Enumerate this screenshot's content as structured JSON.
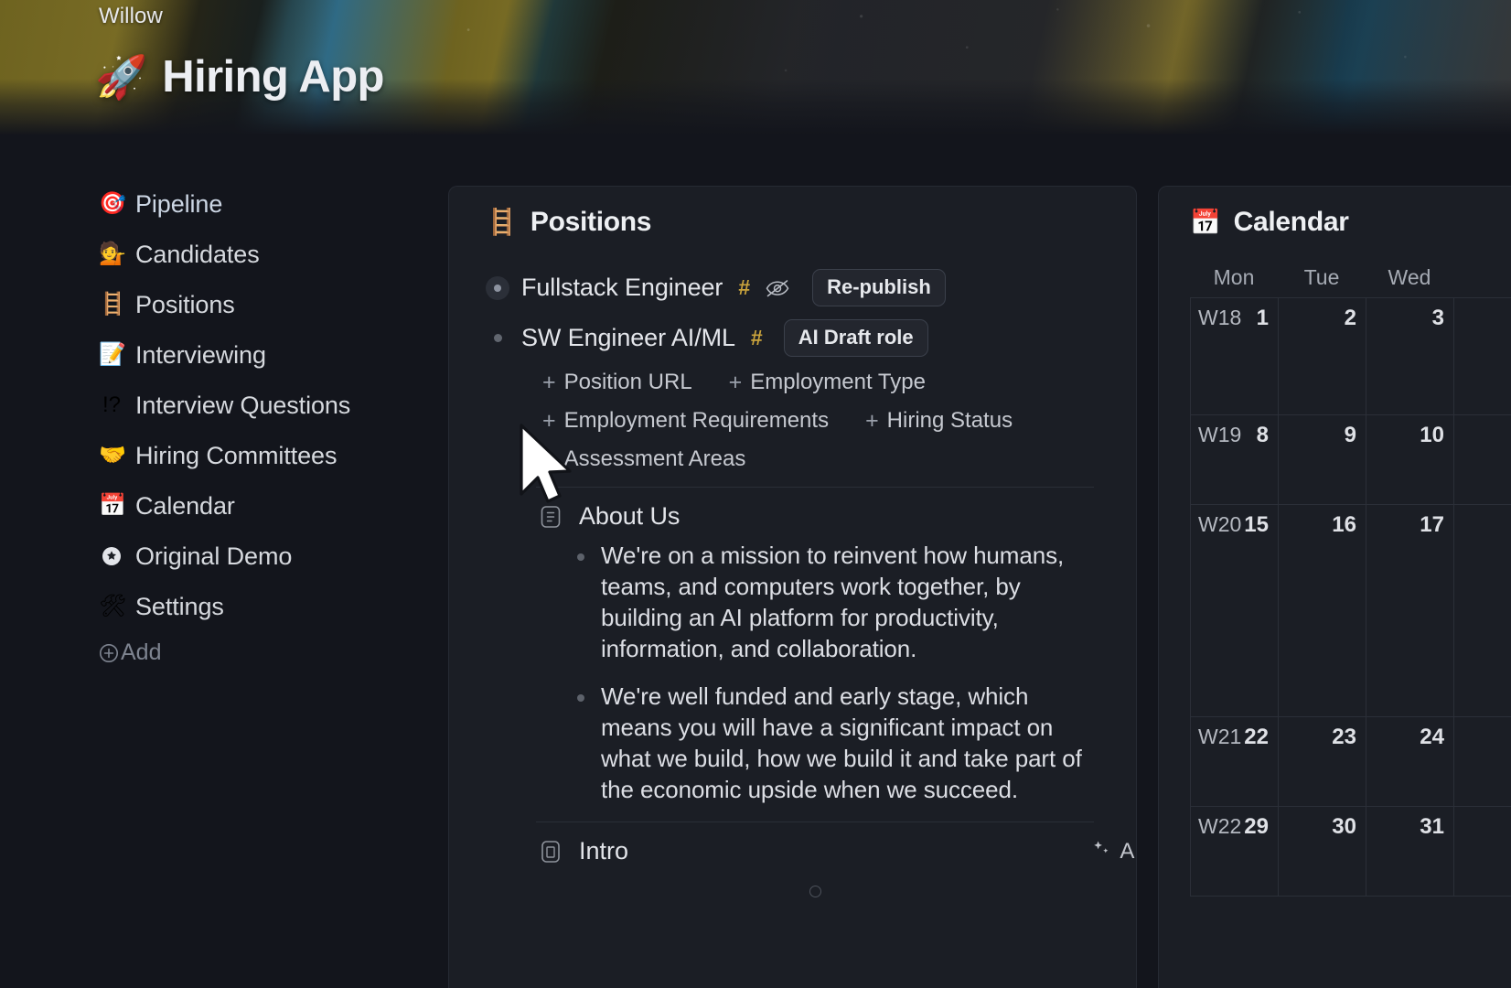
{
  "banner": {
    "workspace": "Willow",
    "page_emoji": "🚀",
    "page_title": "Hiring App"
  },
  "sidebar": {
    "items": [
      {
        "emoji": "🎯",
        "label": "Pipeline"
      },
      {
        "emoji": "💁",
        "label": "Candidates"
      },
      {
        "emoji": "🪜",
        "label": "Positions"
      },
      {
        "emoji": "📝",
        "label": "Interviewing"
      },
      {
        "emoji": "!?",
        "label": "Interview Questions"
      },
      {
        "emoji": "🤝",
        "label": "Hiring Committees"
      },
      {
        "emoji": "📅",
        "label": "Calendar"
      },
      {
        "emoji": "✪",
        "label": "Original Demo"
      },
      {
        "emoji": "🛠",
        "label": "Settings"
      }
    ],
    "add_label": "Add"
  },
  "positions": {
    "emoji": "🪜",
    "title": "Positions",
    "rows": [
      {
        "name": "Fullstack Engineer",
        "hash": "#",
        "hidden_icon": "eye-off-icon",
        "tag": "Re-publish"
      },
      {
        "name": "SW Engineer AI/ML",
        "hash": "#",
        "tag": "AI Draft role"
      }
    ],
    "property_chips": [
      [
        "Position URL",
        "Employment Type"
      ],
      [
        "Employment Requirements",
        "Hiring Status"
      ],
      [
        "Assessment Areas"
      ]
    ],
    "about": {
      "heading": "About Us",
      "bullets": [
        "We're on a mission to reinvent how humans, teams, and computers work together, by building an AI platform for productivity, information, and collaboration.",
        "We're well funded and early stage, which means you will have a significant impact on what we build, how we build it and take part of the economic upside when we succeed."
      ]
    },
    "intro": {
      "label": "Intro",
      "ai_label": "AI"
    }
  },
  "calendar": {
    "emoji": "📅",
    "title": "Calendar",
    "daynames": [
      "Mon",
      "Tue",
      "Wed"
    ],
    "weeks": [
      {
        "week": "W18",
        "days": [
          "1",
          "2",
          "3"
        ]
      },
      {
        "week": "W19",
        "days": [
          "8",
          "9",
          "10"
        ]
      },
      {
        "week": "W20",
        "days": [
          "15",
          "16",
          "17"
        ]
      },
      {
        "week": "W21",
        "days": [
          "22",
          "23",
          "24"
        ]
      },
      {
        "week": "W22",
        "days": [
          "29",
          "30",
          "31"
        ]
      }
    ]
  },
  "colors": {
    "page_bg": "#13151c",
    "panel_bg": "#1b1e25",
    "panel_border": "#262a33",
    "text_primary": "#e4e6eb",
    "text_muted": "#a6abb4",
    "hash_gold": "#c9a33c"
  }
}
